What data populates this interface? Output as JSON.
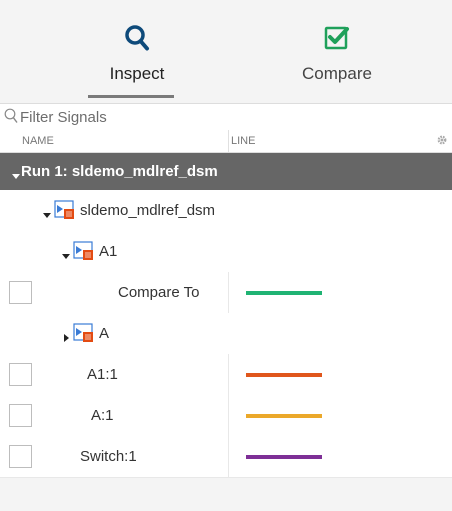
{
  "toolbar": {
    "inspect_label": "Inspect",
    "compare_label": "Compare",
    "inspect_icon": "search-icon",
    "compare_icon": "checkbox-check-icon",
    "accent": "#0e4a7a",
    "compare_accent": "#1fa05a"
  },
  "filter": {
    "placeholder": "Filter Signals",
    "value": ""
  },
  "columns": {
    "name": "NAME",
    "line": "LINE"
  },
  "run": {
    "label": "Run 1: sldemo_mdlref_dsm"
  },
  "tree": [
    {
      "label": "sldemo_mdlref_dsm",
      "type": "model",
      "expanded": true,
      "icon": "model-reference-icon"
    },
    {
      "label": "A1",
      "type": "model",
      "expanded": true,
      "icon": "model-reference-icon"
    },
    {
      "label": "Compare To",
      "type": "signal",
      "checked": false,
      "line_color": "#1fb373"
    },
    {
      "label": "A",
      "type": "model",
      "expanded": false,
      "icon": "model-reference-icon"
    },
    {
      "label": "A1:1",
      "type": "signal",
      "checked": false,
      "line_color": "#e0561c"
    },
    {
      "label": "A:1",
      "type": "signal",
      "checked": false,
      "line_color": "#eba82a"
    },
    {
      "label": "Switch:1",
      "type": "signal",
      "checked": false,
      "line_color": "#7e2f96"
    }
  ]
}
